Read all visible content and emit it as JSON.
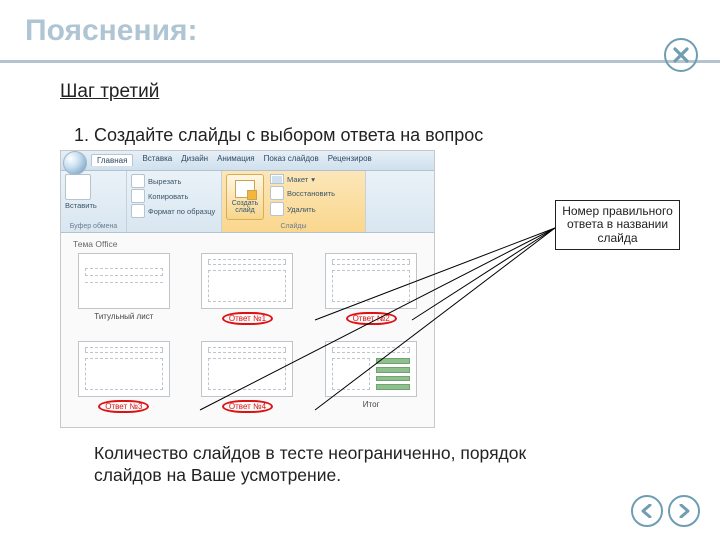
{
  "title_watermark": "Пояснения:",
  "close_label": "Закрыть",
  "step_title": "Шаг третий",
  "step_text": "1. Создайте слайды с выбором ответа на вопрос",
  "footer_text": "Количество слайдов в тесте неограниченно, порядок слайдов на Ваше усмотрение.",
  "nav": {
    "prev": "Назад",
    "next": "Вперёд"
  },
  "callout": "Номер правильного ответа в названии слайда",
  "shot": {
    "tabs": [
      "Главная",
      "Вставка",
      "Дизайн",
      "Анимация",
      "Показ слайдов",
      "Рецензиров"
    ],
    "clipboard": {
      "paste": "Вставить",
      "cut": "Вырезать",
      "copy": "Копировать",
      "format": "Формат по образцу",
      "group": "Буфер обмена"
    },
    "slides": {
      "new_slide": "Создать слайд",
      "layout": "Макет",
      "reset": "Восстановить",
      "delete": "Удалить",
      "group": "Слайды"
    },
    "gallery_header": "Тема Office",
    "layouts": [
      {
        "caption": "Титульный лист",
        "marked": false,
        "kind": "title"
      },
      {
        "caption": "Ответ №1",
        "marked": true,
        "kind": "content"
      },
      {
        "caption": "Ответ №2",
        "marked": true,
        "kind": "content"
      },
      {
        "caption": "Ответ №3",
        "marked": true,
        "kind": "content"
      },
      {
        "caption": "Ответ №4",
        "marked": true,
        "kind": "content"
      },
      {
        "caption": "Итог",
        "marked": false,
        "kind": "itog"
      }
    ]
  }
}
